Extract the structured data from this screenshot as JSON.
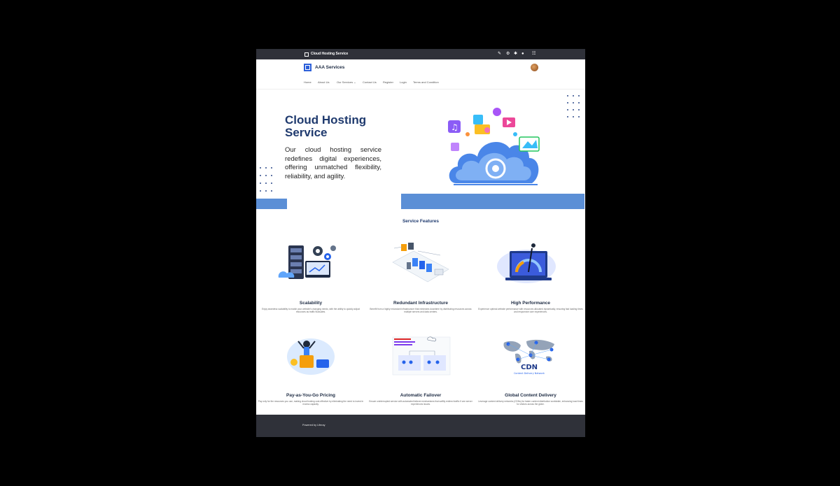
{
  "topbar": {
    "page_title": "Cloud Hosting Service",
    "icons": [
      "pencil-icon",
      "gear-icon",
      "settings-icon",
      "info-icon",
      "grid-icon"
    ]
  },
  "header": {
    "brand": "AAA Services"
  },
  "nav": {
    "items": [
      {
        "label": "Home"
      },
      {
        "label": "About Us"
      },
      {
        "label": "Our Services",
        "has_dropdown": true
      },
      {
        "label": "Contact Us"
      },
      {
        "label": "Register"
      },
      {
        "label": "Login"
      },
      {
        "label": "Terms and Condition"
      }
    ],
    "dropdown_glyph": "⌄"
  },
  "hero": {
    "title_line1": "Cloud Hosting",
    "title_line2": "Service",
    "text": "Our cloud hosting service redefines digital experiences, offering unmatched flexibility, reliability, and agility."
  },
  "features": {
    "heading": "Service Features",
    "items": [
      {
        "title": "Scalability",
        "desc": "Enjoy seamless scalability to match your website's changing needs, with the ability to quickly adjust resources as traffic fluctuates.",
        "icon": "server-gears-icon"
      },
      {
        "title": "Redundant Infrastructure",
        "desc": "Benefit from a highly redundant infrastructure that minimizes downtime by distributing resources across multiple servers and data centers.",
        "icon": "data-center-icon"
      },
      {
        "title": "High Performance",
        "desc": "Experience optimal website performance with resources allocated dynamically, ensuring fast loading times and responsive user experiences.",
        "icon": "speedometer-icon"
      },
      {
        "title": "Pay-as-You-Go Pricing",
        "desc": "Pay only for the resources you use, making cloud hosting cost-effective by eliminating the need to invest in excess capacity.",
        "icon": "payment-icon"
      },
      {
        "title": "Automatic Failover",
        "desc": "Ensure uninterrupted service with automated failover mechanisms that swiftly redirect traffic if one server experiences issues.",
        "icon": "failover-diagram-icon"
      },
      {
        "title": "Global Content Delivery",
        "desc": "Leverage content delivery networks (CDNs) for faster content distribution worldwide, enhancing load times for visitors across the globe.",
        "icon": "cdn-map-icon"
      }
    ]
  },
  "feature_images": {
    "cdn_label": "CDN",
    "cdn_sublabel": "Content Delivery Network"
  },
  "footer": {
    "text": "Powered by Liferay"
  },
  "colors": {
    "topbar_bg": "#2f3139",
    "brand_blue": "#1f3a6e",
    "accent_band": "#5b8fd6",
    "logo_blue": "#2b5fd9"
  }
}
